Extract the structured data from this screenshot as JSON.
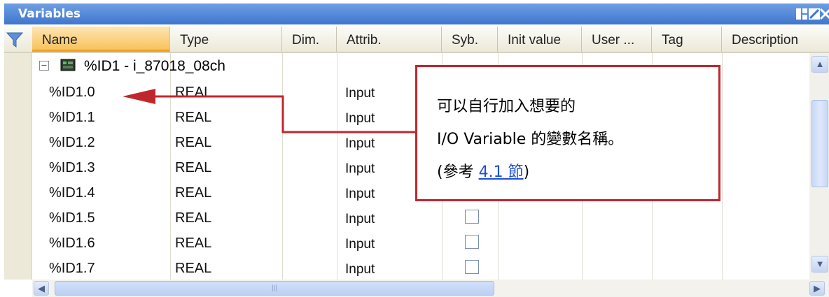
{
  "window": {
    "title": "Variables"
  },
  "columns": [
    "Name",
    "Type",
    "Dim.",
    "Attrib.",
    "Syb.",
    "Init value",
    "User ...",
    "Tag",
    "Description"
  ],
  "group": {
    "expander": "⊟",
    "label": "%ID1 - i_87018_08ch"
  },
  "rows": [
    {
      "name": "%ID1.0",
      "type": "REAL",
      "attrib": "Input"
    },
    {
      "name": "%ID1.1",
      "type": "REAL",
      "attrib": "Input"
    },
    {
      "name": "%ID1.2",
      "type": "REAL",
      "attrib": "Input"
    },
    {
      "name": "%ID1.3",
      "type": "REAL",
      "attrib": "Input"
    },
    {
      "name": "%ID1.4",
      "type": "REAL",
      "attrib": "Input"
    },
    {
      "name": "%ID1.5",
      "type": "REAL",
      "attrib": "Input"
    },
    {
      "name": "%ID1.6",
      "type": "REAL",
      "attrib": "Input"
    },
    {
      "name": "%ID1.7",
      "type": "REAL",
      "attrib": "Input"
    }
  ],
  "callout": {
    "line1": "可以自行加入想要的",
    "line2_a": "I/O Variable",
    "line2_b": " 的變數名稱。",
    "line3_a": "(參考 ",
    "line3_link": "4.1 節",
    "line3_b": ")"
  },
  "colors": {
    "accent": "#c0272d",
    "title_bar": "#3f76cf",
    "link": "#1f4fd4"
  },
  "icons": [
    "filter-icon",
    "dock-icon",
    "undock-icon",
    "close-icon",
    "device-icon",
    "scroll-up-icon",
    "scroll-down-icon",
    "scroll-left-icon",
    "scroll-right-icon"
  ]
}
